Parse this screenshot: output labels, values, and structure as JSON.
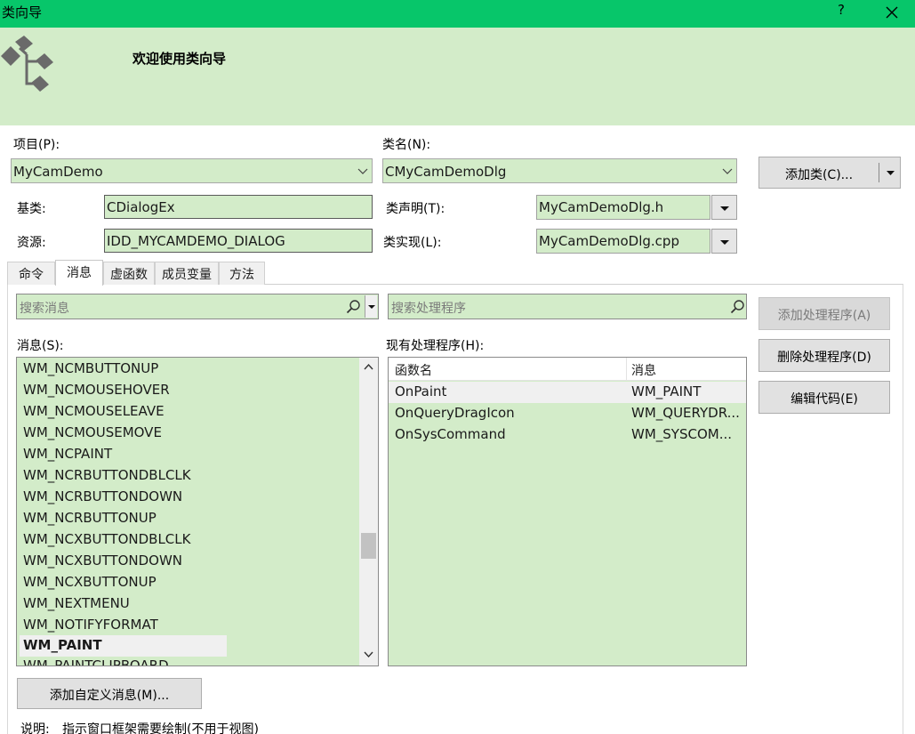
{
  "window": {
    "title": "类向导",
    "help_symbol": "?",
    "banner_heading": "欢迎使用类向导"
  },
  "project": {
    "label": "项目(P):",
    "value": "MyCamDemo"
  },
  "class": {
    "label": "类名(N):",
    "value": "CMyCamDemoDlg"
  },
  "add_class_button": "添加类(C)...",
  "base_class": {
    "label": "基类:",
    "value": "CDialogEx"
  },
  "resource": {
    "label": "资源:",
    "value": "IDD_MYCAMDEMO_DIALOG"
  },
  "class_declaration": {
    "label": "类声明(T):",
    "value": "MyCamDemoDlg.h"
  },
  "class_implementation": {
    "label": "类实现(L):",
    "value": "MyCamDemoDlg.cpp"
  },
  "tabs": [
    {
      "label": "命令",
      "active": false
    },
    {
      "label": "消息",
      "active": true
    },
    {
      "label": "虚函数",
      "active": false
    },
    {
      "label": "成员变量",
      "active": false
    },
    {
      "label": "方法",
      "active": false
    }
  ],
  "search_messages": {
    "placeholder": "搜索消息"
  },
  "search_handlers": {
    "placeholder": "搜索处理程序"
  },
  "messages": {
    "label": "消息(S):",
    "items": [
      "WM_NCMBUTTONUP",
      "WM_NCMOUSEHOVER",
      "WM_NCMOUSELEAVE",
      "WM_NCMOUSEMOVE",
      "WM_NCPAINT",
      "WM_NCRBUTTONDBLCLK",
      "WM_NCRBUTTONDOWN",
      "WM_NCRBUTTONUP",
      "WM_NCXBUTTONDBLCLK",
      "WM_NCXBUTTONDOWN",
      "WM_NCXBUTTONUP",
      "WM_NEXTMENU",
      "WM_NOTIFYFORMAT",
      "WM_PAINT",
      "WM_PAINTCLIPBOARD"
    ],
    "selected": "WM_PAINT"
  },
  "handlers": {
    "label": "现有处理程序(H):",
    "columns": [
      "函数名",
      "消息"
    ],
    "rows": [
      [
        "OnPaint",
        "WM_PAINT"
      ],
      [
        "OnQueryDragIcon",
        "WM_QUERYDR..."
      ],
      [
        "OnSysCommand",
        "WM_SYSCOM..."
      ]
    ]
  },
  "buttons": {
    "add_handler": "添加处理程序(A)",
    "delete_handler": "删除处理程序(D)",
    "edit_code": "编辑代码(E)",
    "add_custom_message": "添加自定义消息(M)..."
  },
  "description": {
    "label": "说明:",
    "text": "指示窗口框架需要绘制(不用于视图)"
  },
  "colors": {
    "titlebar": "#07c66a",
    "banner": "#d3ecc9",
    "field_bg": "#d3ecc9"
  }
}
